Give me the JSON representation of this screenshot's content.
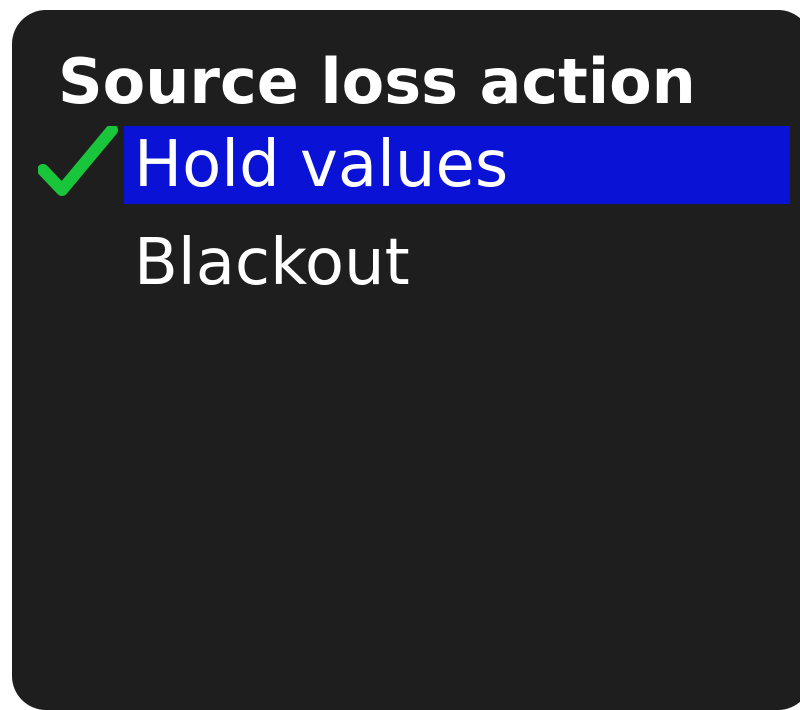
{
  "title": "Source loss action",
  "options": [
    {
      "label": "Hold values",
      "selected": true
    },
    {
      "label": "Blackout",
      "selected": false
    }
  ],
  "colors": {
    "panel_background": "#1e1e1e",
    "highlight": "#0a12d6",
    "check": "#19c63b",
    "text": "#ffffff"
  },
  "icons": {
    "selected_marker": "checkmark-icon"
  }
}
